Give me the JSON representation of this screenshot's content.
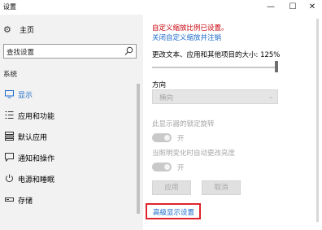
{
  "window": {
    "title": "设置",
    "minimize": "—",
    "maximize": "☐",
    "close": "✕"
  },
  "sidebar": {
    "home_label": "主页",
    "search_placeholder": "查找设置",
    "section_label": "系统",
    "items": [
      {
        "label": "显示",
        "icon": "monitor-icon",
        "active": true
      },
      {
        "label": "应用和功能",
        "icon": "apps-list-icon",
        "active": false
      },
      {
        "label": "默认应用",
        "icon": "default-apps-icon",
        "active": false
      },
      {
        "label": "通知和操作",
        "icon": "notification-icon",
        "active": false
      },
      {
        "label": "电源和睡眠",
        "icon": "power-icon",
        "active": false
      },
      {
        "label": "存储",
        "icon": "storage-icon",
        "active": false
      }
    ]
  },
  "display": {
    "custom_scale_warning": "自定义缩放比例已设置。",
    "turn_off_custom_scale_link": "关闭自定义缩放并注销",
    "scale_label": "更改文本、应用和其他项目的大小: 125%",
    "scale_percent": 125,
    "orientation_label": "方向",
    "orientation_value": "横向",
    "rotation_lock_label": "此显示器的锁定旋转",
    "rotation_lock_state": "开",
    "auto_brightness_label": "当照明变化时自动更改亮度",
    "auto_brightness_state": "开",
    "apply_button": "应用",
    "cancel_button": "取消",
    "advanced_link": "高级显示设置"
  },
  "colors": {
    "accent": "#1b6ac9",
    "warning": "#c8000a",
    "highlight_box": "#e0242b"
  }
}
